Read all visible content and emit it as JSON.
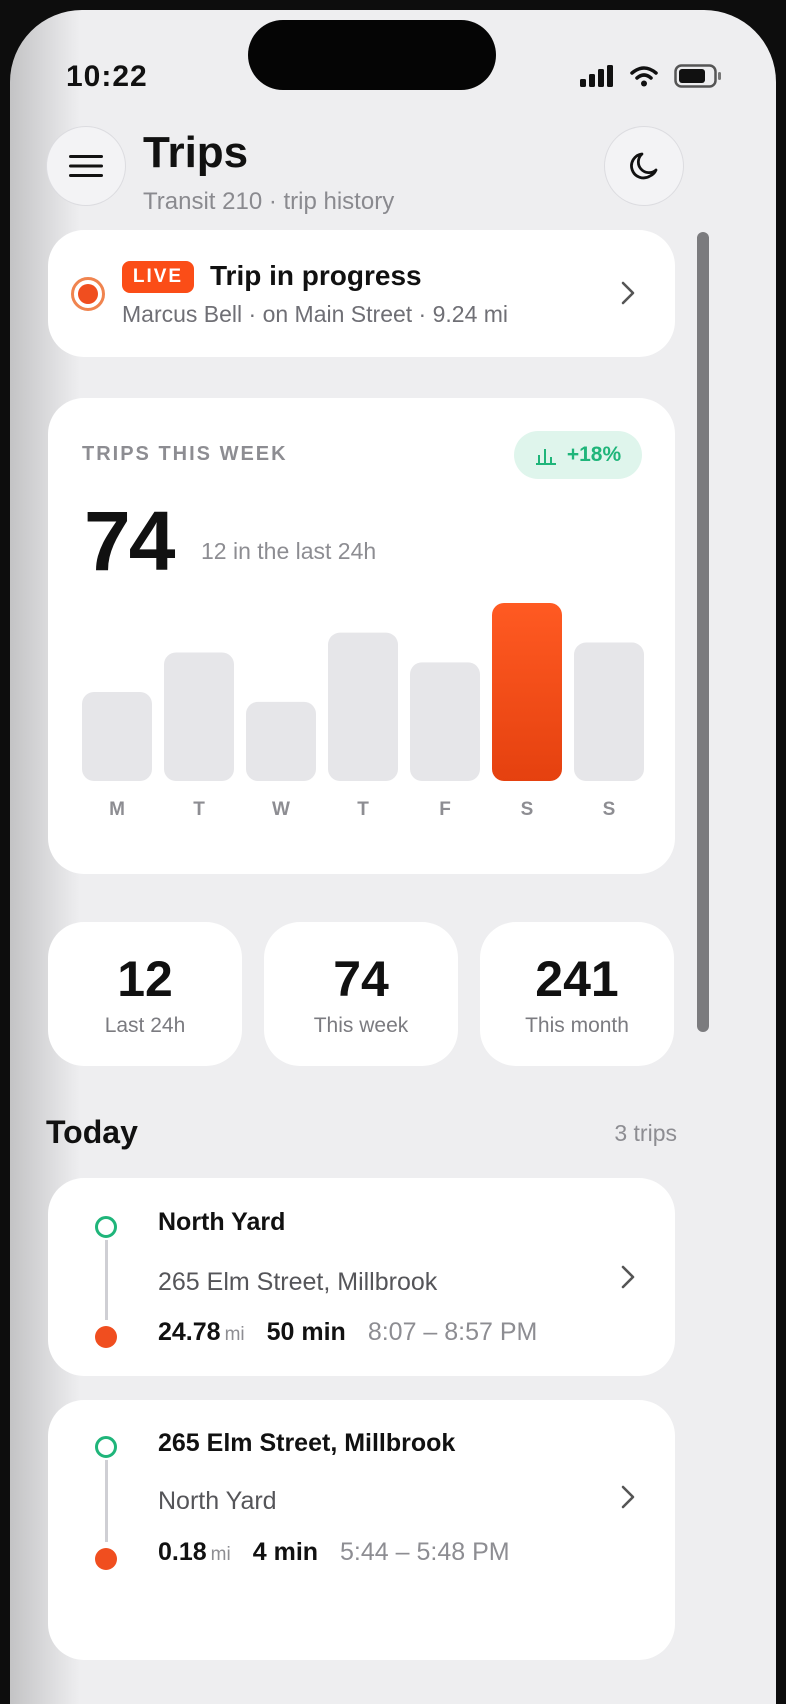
{
  "status_bar": {
    "time": "10:22"
  },
  "header": {
    "title": "Trips",
    "subtitle": "Transit 210 · trip history"
  },
  "live_trip": {
    "badge": "LIVE",
    "title": "Trip in progress",
    "detail": "Marcus Bell · on Main Street · 9.24 mi"
  },
  "weekly": {
    "label": "TRIPS THIS WEEK",
    "trend": "+18%",
    "total": "74",
    "total_sub": "12 in the last 24h"
  },
  "chart_data": {
    "type": "bar",
    "categories": [
      "M",
      "T",
      "W",
      "T",
      "F",
      "S",
      "S"
    ],
    "values": [
      9,
      13,
      8,
      15,
      12,
      18,
      14
    ],
    "highlight_index": 5,
    "highlight_color": "#fb4d17",
    "bar_color": "#e6e6e9"
  },
  "stats": [
    {
      "value": "12",
      "label": "Last 24h"
    },
    {
      "value": "74",
      "label": "This week"
    },
    {
      "value": "241",
      "label": "This month"
    }
  ],
  "today": {
    "title": "Today",
    "count": "3 trips",
    "trips": [
      {
        "from": "North Yard",
        "to": "265 Elm Street, Millbrook",
        "distance": "24.78",
        "unit": "mi",
        "duration": "50 min",
        "time": "8:07 – 8:57 PM"
      },
      {
        "from": "265 Elm Street, Millbrook",
        "to": "North Yard",
        "distance": "0.18",
        "unit": "mi",
        "duration": "4 min",
        "time": "5:44 – 5:48 PM"
      }
    ]
  },
  "colors": {
    "accent": "#fb4d17",
    "positive": "#1fb57a",
    "background": "#eeeef0"
  },
  "icons": {
    "menu": "menu-icon",
    "theme": "moon-icon",
    "chevron": "chevron-right-icon",
    "trend": "bar-chart-icon"
  }
}
